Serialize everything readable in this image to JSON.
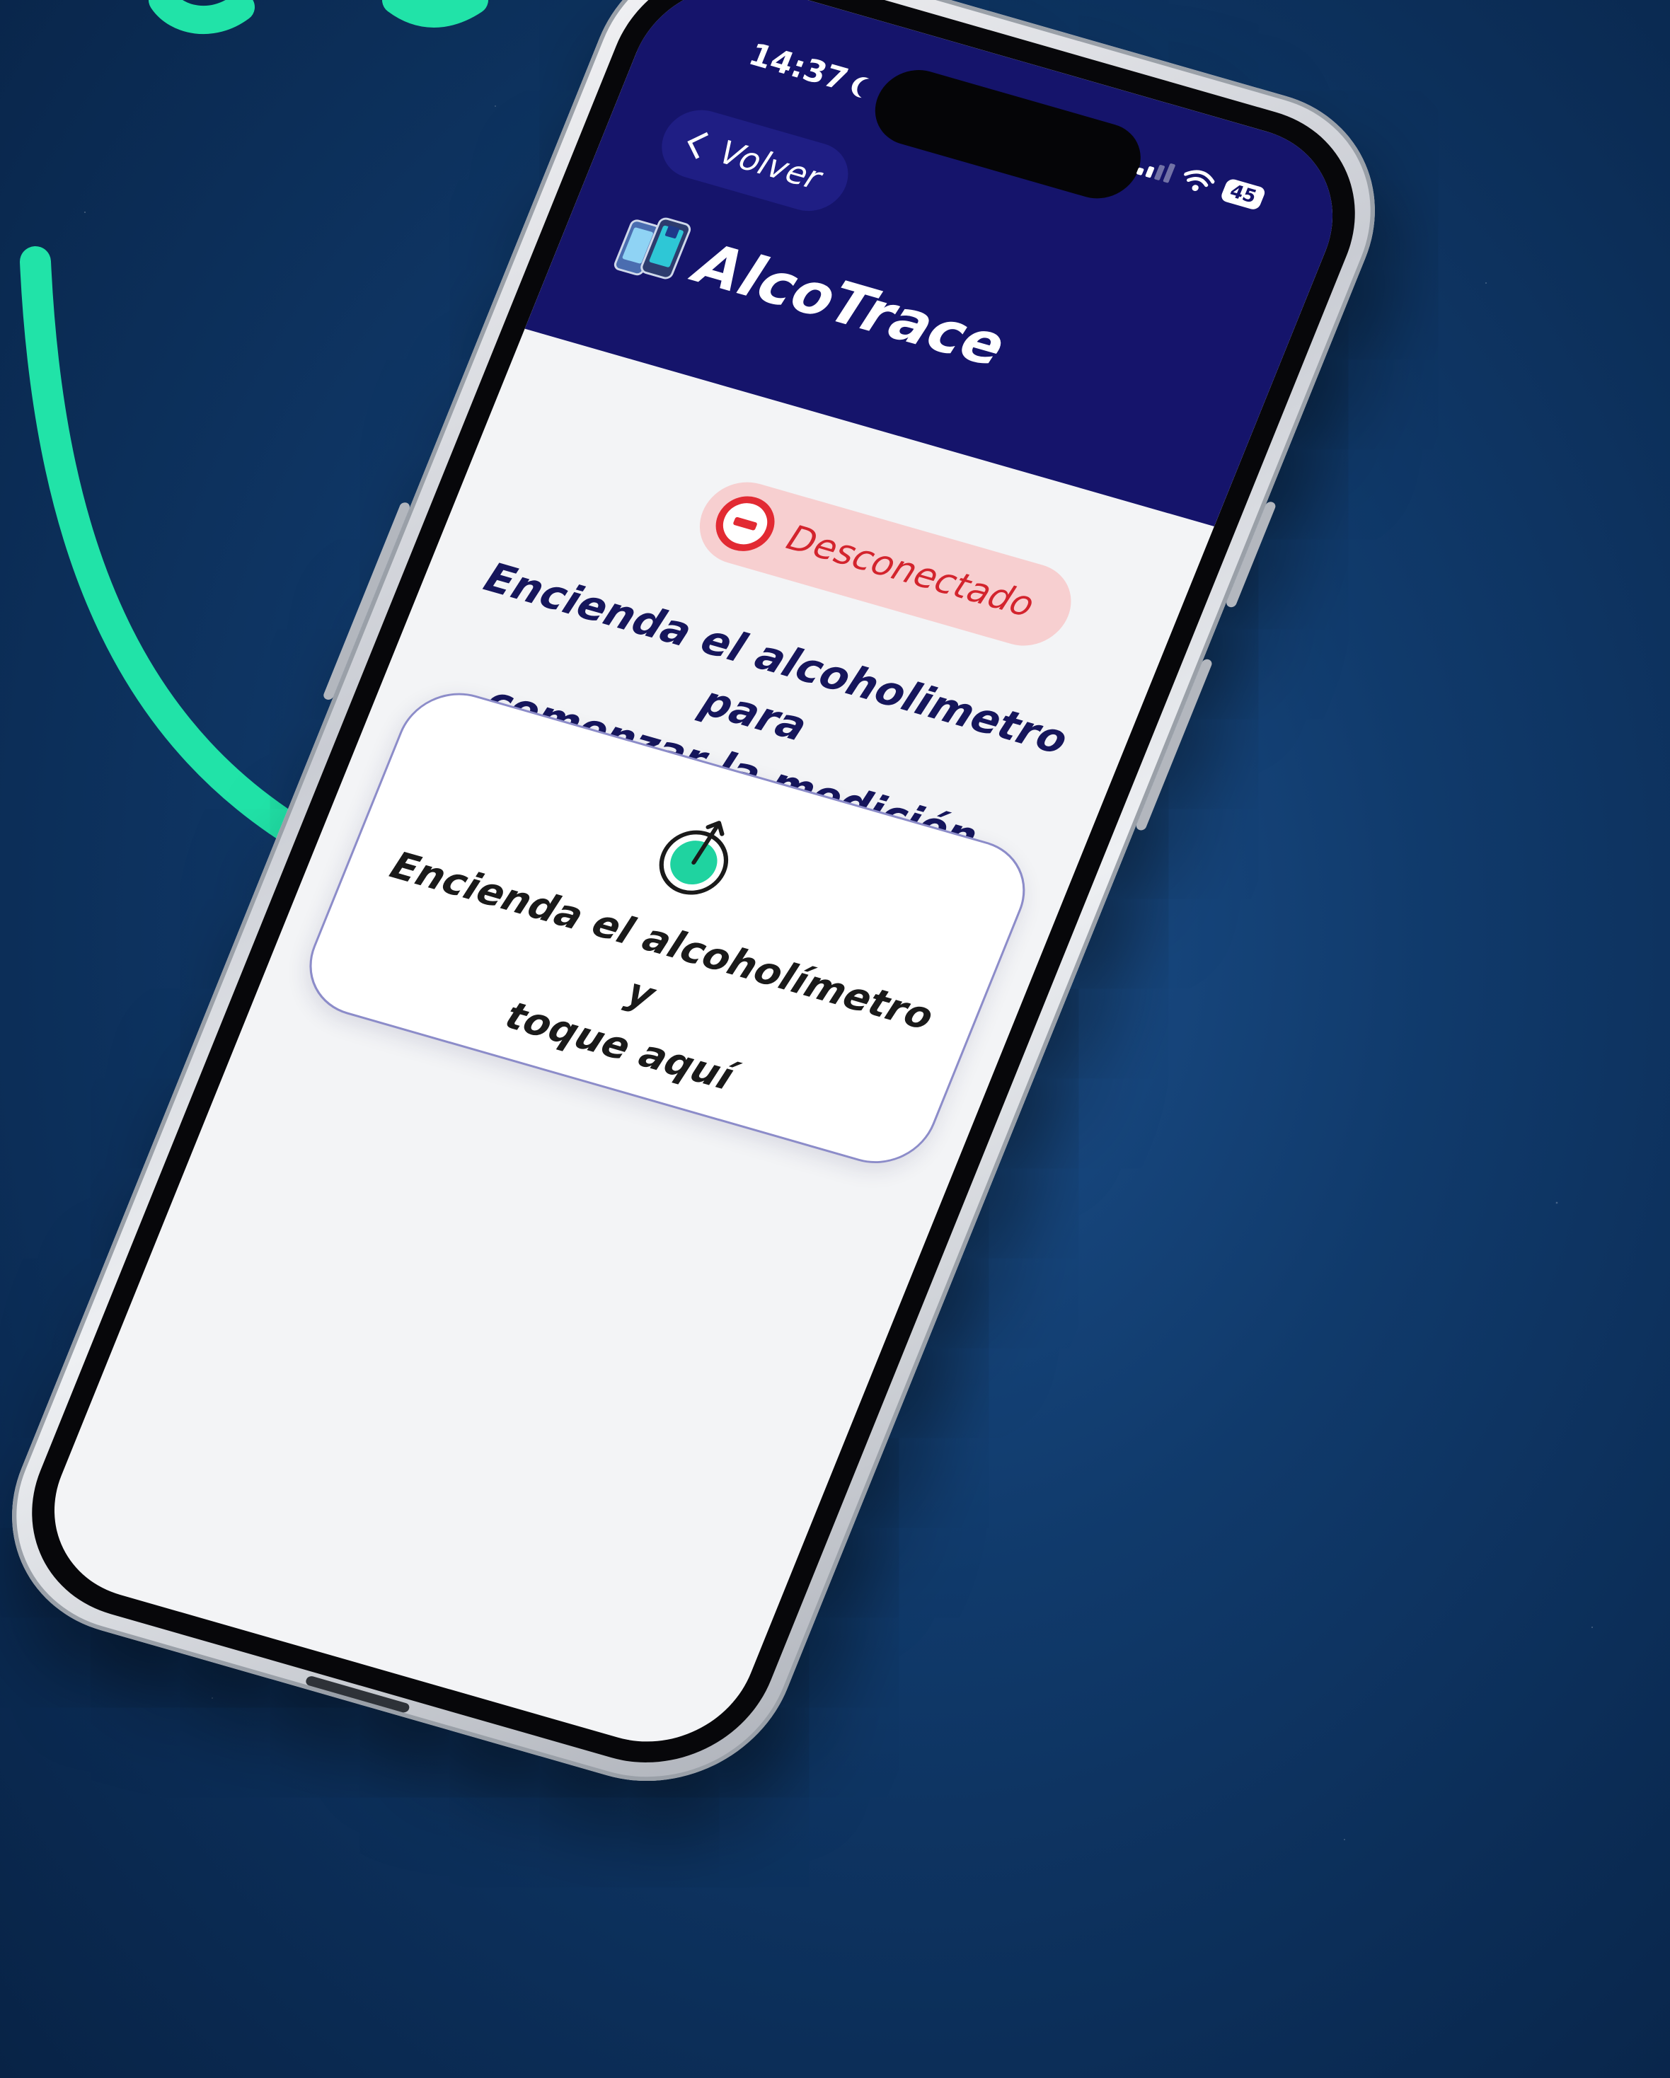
{
  "status_bar": {
    "time": "14:37",
    "battery": "45"
  },
  "header": {
    "back_label": "Volver",
    "app_title": "AlcoTrace"
  },
  "connection": {
    "status_label": "Desconectado"
  },
  "main": {
    "instruction_line1": "Encienda el alcoholimetro para",
    "instruction_line2": "comenzar la medición",
    "card_line1": "Encienda el alcoholímetro y",
    "card_line2": "toque aquí"
  },
  "colors": {
    "header_bg": "#15146b",
    "accent_green": "#1fd3a0",
    "error_red": "#e22a33",
    "pill_bg": "#f7cfd0"
  },
  "icons": {
    "back": "chevron-left-icon",
    "brand": "phone-breathalyzer-icon",
    "status": "minus-circle-icon",
    "card": "power-icon"
  }
}
